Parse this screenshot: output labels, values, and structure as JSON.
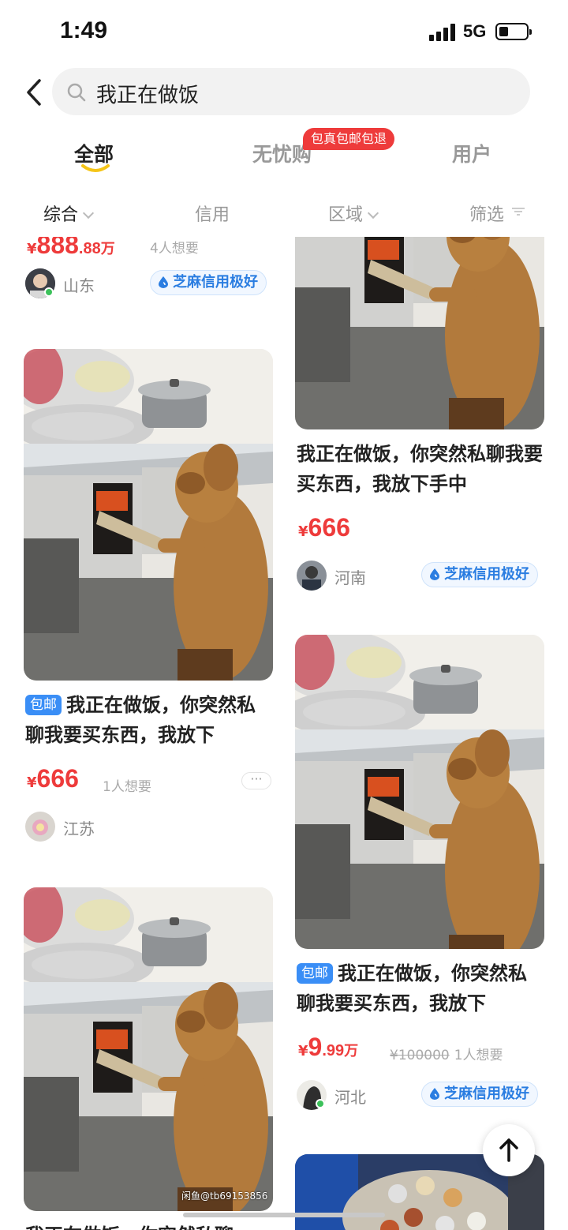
{
  "status": {
    "time": "1:49",
    "network": "5G"
  },
  "search": {
    "query": "我正在做饭"
  },
  "tabs": [
    {
      "label": "全部"
    },
    {
      "label": "无忧购"
    },
    {
      "label": "用户"
    }
  ],
  "promo_badge": "包真包邮包退",
  "filters": [
    {
      "label": "综合"
    },
    {
      "label": "信用"
    },
    {
      "label": "区域"
    },
    {
      "label": "筛选"
    }
  ],
  "items": [
    {
      "price_cur": "¥",
      "price_int": "888",
      "price_dec": ".88",
      "price_unit": "万",
      "want": "4人想要",
      "region": "山东",
      "credit": "芝麻信用极好"
    },
    {
      "badge": "包邮",
      "title": "我正在做饭，你突然私聊我要买东西，我放下",
      "price_cur": "¥",
      "price_int": "666",
      "want": "1人想要",
      "more": "···",
      "region": "江苏"
    },
    {
      "title": "我正在做饭，你突然私聊",
      "watermark": "闲鱼@tb69153856"
    },
    {
      "title": "我正在做饭，你突然私聊我要买东西，我放下手中",
      "price_cur": "¥",
      "price_int": "666",
      "region": "河南",
      "credit": "芝麻信用极好"
    },
    {
      "badge": "包邮",
      "title": "我正在做饭，你突然私聊我要买东西，我放下",
      "price_cur": "¥",
      "price_int": "9",
      "price_dec": ".99",
      "price_unit": "万",
      "original_price": "¥100000",
      "want": "1人想要",
      "region": "河北",
      "credit": "芝麻信用极好"
    }
  ],
  "colors": {
    "accent_price": "#ee3b3b",
    "credit_blue": "#2a7de1",
    "tab_underline": "#f5c518"
  }
}
